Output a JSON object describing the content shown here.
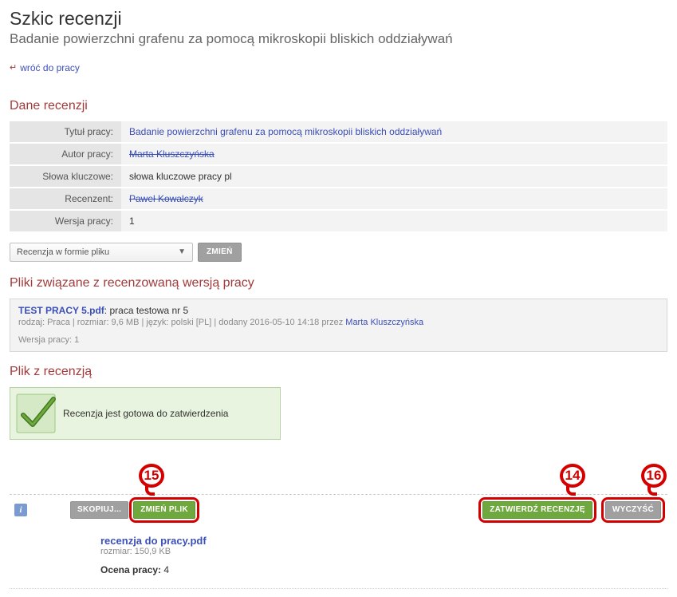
{
  "header": {
    "title": "Szkic recenzji",
    "subtitle": "Badanie powierzchni grafenu za pomocą mikroskopii bliskich oddziaływań"
  },
  "back_link": "wróć do pracy",
  "sections": {
    "data": "Dane recenzji",
    "files": "Pliki związane z recenzowaną wersją pracy",
    "review_file": "Plik z recenzją"
  },
  "fields": {
    "title": {
      "label": "Tytuł pracy:",
      "value": "Badanie powierzchni grafenu za pomocą mikroskopii bliskich oddziaływań"
    },
    "author": {
      "label": "Autor pracy:",
      "value": "Marta Kluszczyńska"
    },
    "keywords": {
      "label": "Słowa kluczowe:",
      "value": "słowa kluczowe pracy pl"
    },
    "reviewer": {
      "label": "Recenzent:",
      "value": "Paweł Kowalczyk"
    },
    "version": {
      "label": "Wersja pracy:",
      "value": "1"
    }
  },
  "dropdown": {
    "selected": "Recenzja w formie pliku",
    "change_btn": "ZMIEŃ"
  },
  "file": {
    "name": "TEST PRACY 5.pdf",
    "desc": "praca testowa nr 5",
    "meta_prefix": "rodzaj: Praca | rozmiar: 9,6 MB | język: polski [PL] | dodany 2016-05-10 14:18 przez ",
    "uploader": "Marta Kluszczyńska",
    "version": "Wersja pracy: 1"
  },
  "ready": {
    "text": "Recenzja jest gotowa do zatwierdzenia"
  },
  "annotations": {
    "a15": "15",
    "a14": "14",
    "a16": "16"
  },
  "buttons": {
    "copy": "SKOPIUJ...",
    "change_file": "ZMIEŃ PLIK",
    "approve": "ZATWIERDŹ RECENZJĘ",
    "clear": "WYCZYŚĆ"
  },
  "review": {
    "filename": "recenzja do pracy.pdf",
    "size": "rozmiar: 150,9 KB",
    "grade_label": "Ocena pracy:",
    "grade_value": "4"
  }
}
